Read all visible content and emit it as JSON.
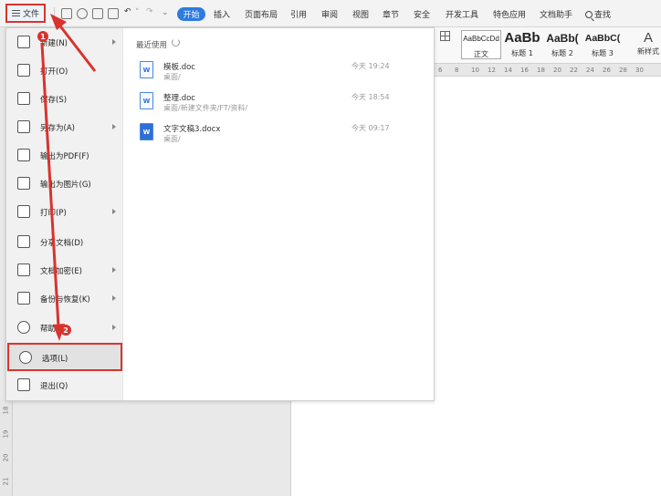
{
  "toolbar": {
    "file_label": "文件",
    "tabs": [
      "开始",
      "插入",
      "页面布局",
      "引用",
      "审阅",
      "视图",
      "章节",
      "安全",
      "开发工具",
      "特色应用",
      "文档助手"
    ],
    "search_label": "查找"
  },
  "ribbon": {
    "styles": [
      {
        "sample": "AaBbCcDd",
        "name": "正文"
      },
      {
        "sample": "AaBb",
        "name": "标题 1"
      },
      {
        "sample": "AaBb(",
        "name": "标题 2"
      },
      {
        "sample": "AaBbC(",
        "name": "标题 3"
      }
    ],
    "new_style_glyph": "A",
    "new_style_label": "新样式"
  },
  "ruler": {
    "h_numbers": [
      "6",
      "8",
      "10",
      "12",
      "14",
      "16",
      "18",
      "20",
      "22",
      "24",
      "26",
      "28",
      "30"
    ],
    "v_numbers": [
      "18",
      "19",
      "20",
      "21"
    ]
  },
  "menu": {
    "items": [
      {
        "label": "新建(N)",
        "icon": "new-file-icon",
        "submenu": true
      },
      {
        "label": "打开(O)",
        "icon": "open-folder-icon",
        "submenu": false
      },
      {
        "label": "保存(S)",
        "icon": "save-icon",
        "submenu": false
      },
      {
        "label": "另存为(A)",
        "icon": "save-as-icon",
        "submenu": true
      },
      {
        "label": "输出为PDF(F)",
        "icon": "export-pdf-icon",
        "submenu": false
      },
      {
        "label": "输出为图片(G)",
        "icon": "export-image-icon",
        "submenu": false
      },
      {
        "label": "打印(P)",
        "icon": "print-icon",
        "submenu": true
      },
      {
        "label": "分享文档(D)",
        "icon": "share-icon",
        "submenu": false
      },
      {
        "label": "文档加密(E)",
        "icon": "lock-icon",
        "submenu": true
      },
      {
        "label": "备份与恢复(K)",
        "icon": "backup-icon",
        "submenu": true
      },
      {
        "label": "帮助(H)",
        "icon": "help-icon",
        "submenu": true
      },
      {
        "label": "选项(L)",
        "icon": "gear-icon",
        "submenu": false
      },
      {
        "label": "退出(Q)",
        "icon": "exit-icon",
        "submenu": false
      }
    ]
  },
  "recent": {
    "title": "最近使用",
    "files": [
      {
        "name": "模板.doc",
        "path": "桌面/",
        "time": "今天 19:24"
      },
      {
        "name": "整理.doc",
        "path": "桌面/新建文件夹/FT/资料/",
        "time": "今天 18:54"
      },
      {
        "name": "文字文稿3.docx",
        "path": "桌面/",
        "time": "今天 09:17"
      }
    ]
  },
  "annotations": {
    "badge1": "1",
    "badge2": "2",
    "color": "#d9332e"
  }
}
